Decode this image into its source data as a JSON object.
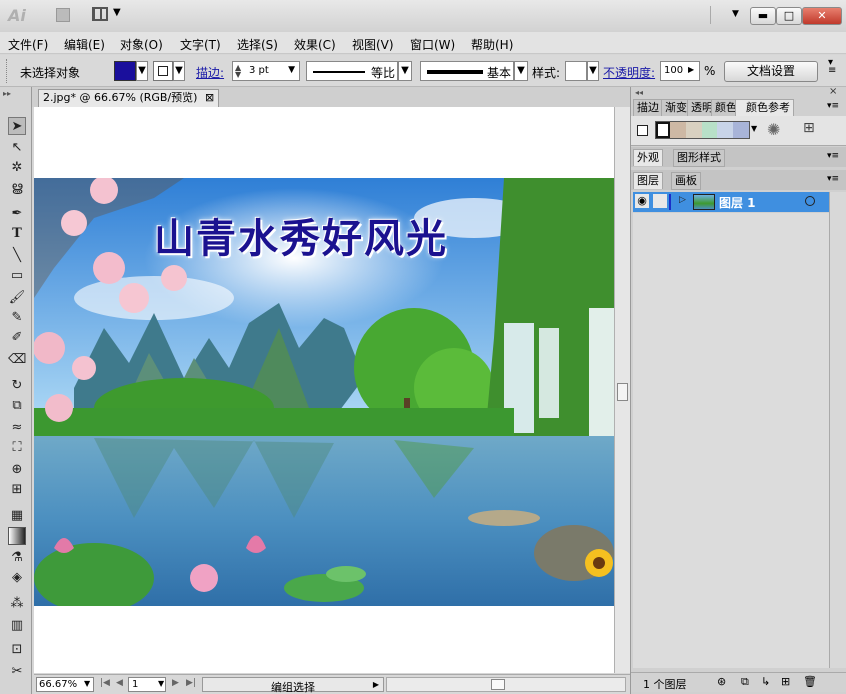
{
  "app": {
    "logo": "Ai"
  },
  "window": {
    "minimize": "▬",
    "maximize": "□",
    "close": "✕"
  },
  "menu": [
    "文件(F)",
    "编辑(E)",
    "对象(O)",
    "文字(T)",
    "选择(S)",
    "效果(C)",
    "视图(V)",
    "窗口(W)",
    "帮助(H)"
  ],
  "control": {
    "selection_status": "未选择对象",
    "stroke_label": "描边:",
    "stroke_weight": "3 pt",
    "profile_uniform": "等比",
    "brush_basic": "基本",
    "style_label": "样式:",
    "opacity_label": "不透明度:",
    "opacity_value": "100",
    "opacity_unit": "%",
    "doc_setup": "文档设置"
  },
  "document": {
    "tab_title": "2.jpg* @ 66.67% (RGB/预览)",
    "close": "⊠"
  },
  "artwork": {
    "headline": "山青水秀好风光"
  },
  "status": {
    "zoom": "66.67%",
    "page": "1",
    "tool": "编组选择"
  },
  "panels": {
    "group1_tabs": [
      "描边",
      "渐变",
      "透明",
      "颜色",
      "颜色参考"
    ],
    "group2_tabs": [
      "外观",
      "图形样式"
    ],
    "group3_tabs": [
      "图层",
      "画板"
    ],
    "layer_name": "图层 1",
    "layer_count": "1 个图层"
  },
  "colors": {
    "fill": "#1a0f9c",
    "selection_blue": "#3f8fe0",
    "swatch_strip": [
      "#cdb8a4",
      "#d8d0c0",
      "#b8e0c8",
      "#c8d4e8",
      "#a8b4d8"
    ]
  },
  "icons": [
    "selection-arrow-icon",
    "direct-select-icon",
    "magic-wand-icon",
    "lasso-icon",
    "pen-icon",
    "type-icon",
    "line-icon",
    "rectangle-icon",
    "paintbrush-icon",
    "pencil-icon",
    "blob-brush-icon",
    "eraser-icon",
    "rotate-icon",
    "scale-icon",
    "warp-icon",
    "free-transform-icon",
    "shape-builder-icon",
    "perspective-icon",
    "mesh-icon",
    "gradient-icon",
    "eyedropper-icon",
    "blend-icon",
    "symbol-sprayer-icon",
    "column-graph-icon",
    "artboard-icon",
    "slice-icon",
    "eye-icon"
  ]
}
